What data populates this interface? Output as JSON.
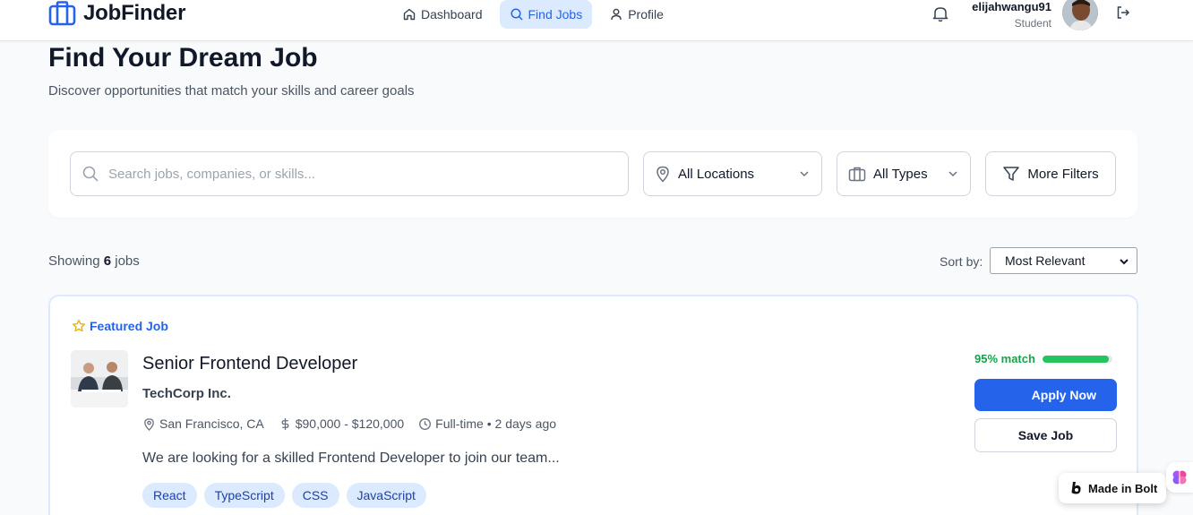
{
  "app": {
    "name": "JobFinder",
    "brand_color": "#2563eb"
  },
  "nav": {
    "items": [
      {
        "label": "Dashboard",
        "icon": "home-icon",
        "active": false
      },
      {
        "label": "Find Jobs",
        "icon": "search-icon",
        "active": true
      },
      {
        "label": "Profile",
        "icon": "user-icon",
        "active": false
      }
    ]
  },
  "user": {
    "name": "elijahwangu91",
    "role": "Student"
  },
  "page": {
    "title": "Find Your Dream Job",
    "subtitle": "Discover opportunities that match your skills and career goals"
  },
  "filters": {
    "search_placeholder": "Search jobs, companies, or skills...",
    "search_value": "",
    "location": "All Locations",
    "type": "All Types",
    "more_label": "More Filters"
  },
  "results": {
    "showing_prefix": "Showing",
    "count": "6",
    "showing_suffix": "jobs",
    "sort_label": "Sort by:",
    "sort_value": "Most Relevant"
  },
  "job": {
    "featured_label": "Featured Job",
    "title": "Senior Frontend Developer",
    "company": "TechCorp Inc.",
    "location": "San Francisco, CA",
    "salary": "$90,000 - $120,000",
    "type_posted": "Full-time • 2 days ago",
    "description": "We are looking for a skilled Frontend Developer to join our team...",
    "tags": [
      "React",
      "TypeScript",
      "CSS",
      "JavaScript"
    ],
    "match_label": "95% match",
    "match_value": 95,
    "apply_label": "Apply Now",
    "save_label": "Save Job"
  },
  "badge": {
    "label": "Made in Bolt"
  }
}
